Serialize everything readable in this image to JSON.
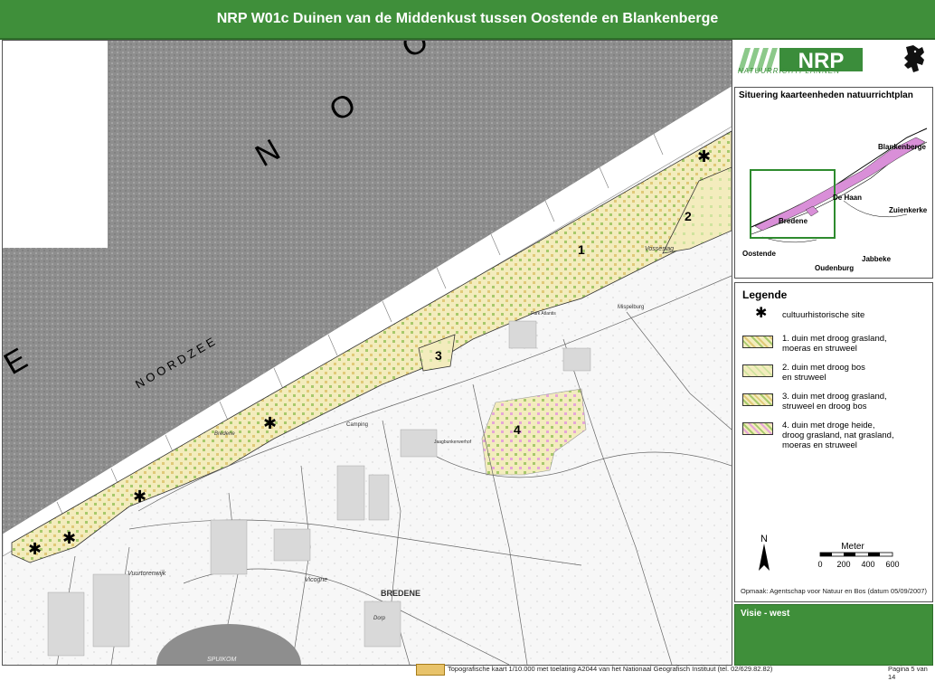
{
  "title": "NRP W01c Duinen van de Middenkust tussen Oostende en Blankenberge",
  "logo": {
    "text": "NRP",
    "subtitle": "NATUURRICHTPLANNEN"
  },
  "colors": {
    "header_green": "#3f8f3a",
    "sea_gray": "#8c8c8c",
    "dune_fill": "#f3ecbd",
    "dot_green": "#a7c96b",
    "dot_pink": "#e6a6d8",
    "situering_pink": "#d98fd8"
  },
  "map": {
    "sea_labels": [
      "N",
      "O",
      "O",
      "R",
      "D",
      "Z",
      "E",
      "E"
    ],
    "sea_letters_large": [
      "N",
      "O",
      "O",
      "E"
    ],
    "noordzee_label": "N O O R D Z E E",
    "unit_numbers": [
      "1",
      "2",
      "3",
      "4"
    ],
    "places": [
      {
        "name": "BREDENE"
      },
      {
        "name": "Vosseslag"
      },
      {
        "name": "Vicogne"
      },
      {
        "name": "Vuurtorenwijk"
      },
      {
        "name": "SPUIKOM"
      },
      {
        "name": "Bredene"
      },
      {
        "name": "Camping"
      },
      {
        "name": "Jaagbunkerwerhof"
      },
      {
        "name": "Dorp"
      },
      {
        "name": "Mispelburg"
      },
      {
        "name": "Park Atlantis"
      }
    ]
  },
  "situering": {
    "title": "Situering kaarteenheden natuurrichtplan",
    "places": [
      "Blankenberge",
      "De Haan",
      "Zuienkerke",
      "Bredene",
      "Oostende",
      "Jabbeke",
      "Oudenburg"
    ]
  },
  "legend": {
    "title": "Legende",
    "items": [
      {
        "label": "cultuurhistorische site",
        "icon": "asterisk-icon"
      },
      {
        "label": "1. duin met droog grasland,\nmoeras en struweel"
      },
      {
        "label": "2. duin met droog bos\nen struweel"
      },
      {
        "label": "3. duin met droog grasland,\nstruweel en droog bos"
      },
      {
        "label": "4. duin met droge heide,\ndroog grasland, nat grasland,\nmoeras en struweel"
      }
    ],
    "north": "N",
    "scale_title": "Meter",
    "scale_ticks": [
      "0",
      "200",
      "400",
      "600"
    ],
    "opmaak": "Opmaak: Agentschap voor Natuur en Bos (datum 05/09/2007)"
  },
  "visie": "Visie - west",
  "footer": {
    "credit": "Topografische kaart 1/10.000 met toelating A2044 van het Nationaal Geografisch Instituut (tel. 02/629.82.82)",
    "page": "Pagina 5 van 14"
  }
}
